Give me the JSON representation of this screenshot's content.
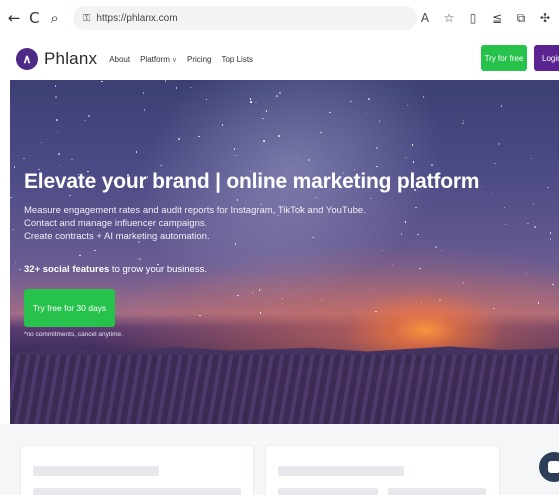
{
  "browser": {
    "url": "https://phlanx.com",
    "back_icon": "←",
    "reload_icon": "C",
    "search_icon": "⌕",
    "lock_icon": "🔒"
  },
  "header": {
    "logo_text": "Phlanx",
    "logo_mark": "∧",
    "nav": [
      "About",
      "Platform",
      "Pricing",
      "Top Lists"
    ],
    "try_button": "Try for free",
    "login_button": "Login"
  },
  "hero": {
    "title": "Elevate your brand | online marketing platform",
    "line1": "Measure engagement rates and audit reports for Instagram, TikTok and YouTube.",
    "line2": "Contact and manage influencer campaigns.",
    "line3": "Create contracts + AI marketing automation.",
    "features_bold": "32+ social features",
    "features_rest": " to grow your business.",
    "cta": "Try free for 30 days",
    "note": "*no commitments, cancel anytime."
  },
  "colors": {
    "accent_green": "#27c24c",
    "brand_purple": "#5a2590"
  }
}
